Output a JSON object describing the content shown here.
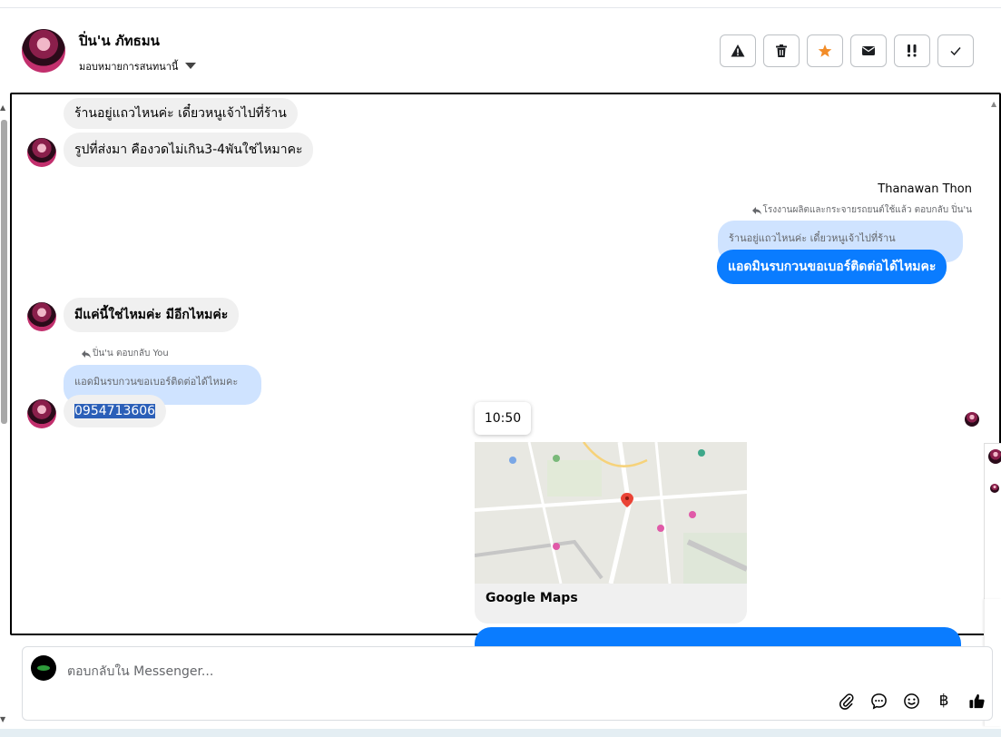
{
  "header": {
    "name": "ปิ่น'น ภัทธมน",
    "assign_label": "มอบหมายการสนทนานี้",
    "actions": [
      "warning",
      "trash",
      "star",
      "mail",
      "spam",
      "done"
    ]
  },
  "colors": {
    "messenger_blue": "#0a7cff",
    "star_orange": "#f28c28",
    "reply_blue_light": "#cfe3ff",
    "bubble_gray": "#f0f0f0"
  },
  "messages": {
    "m1": "ร้านอยู่แถวไหนค่ะ เดี๋ยวหนูเจ้าไปที่ร้าน",
    "m2": "รูปที่ส่งมา คืองวดไม่เกิน3-4พันใช่ไหมาคะ",
    "sender_right": "Thanawan Thon",
    "reply_meta_right": "โรงงานผลิตและกระจายรถยนต์ใช้แล้ว ตอบกลับ ปิ่น'น",
    "quoted_right": "ร้านอยู่แถวไหนค่ะ เดี๋ยวหนูเจ้าไปที่ร้าน",
    "m3_right": "แอดมินรบกวนขอเบอร์ติดต่อได้ไหมคะ",
    "m4": "มีแค่นี้ใช่ไหมค่ะ มีอีกไหมค่ะ",
    "reply_meta_left": "ปิ่น'น ตอบกลับ You",
    "quoted_left": "แอดมินรบกวนขอเบอร์ติดต่อได้ไหมคะ",
    "m5_phone": "0954713606",
    "time_tooltip": "10:50",
    "map_label": "Google Maps"
  },
  "composer": {
    "placeholder": "ตอบกลับใน Messenger...",
    "tools": [
      "attach-icon",
      "chat-icon",
      "emoji-icon",
      "baht-icon",
      "thumbs-up-icon"
    ],
    "currency_glyph": "฿"
  }
}
